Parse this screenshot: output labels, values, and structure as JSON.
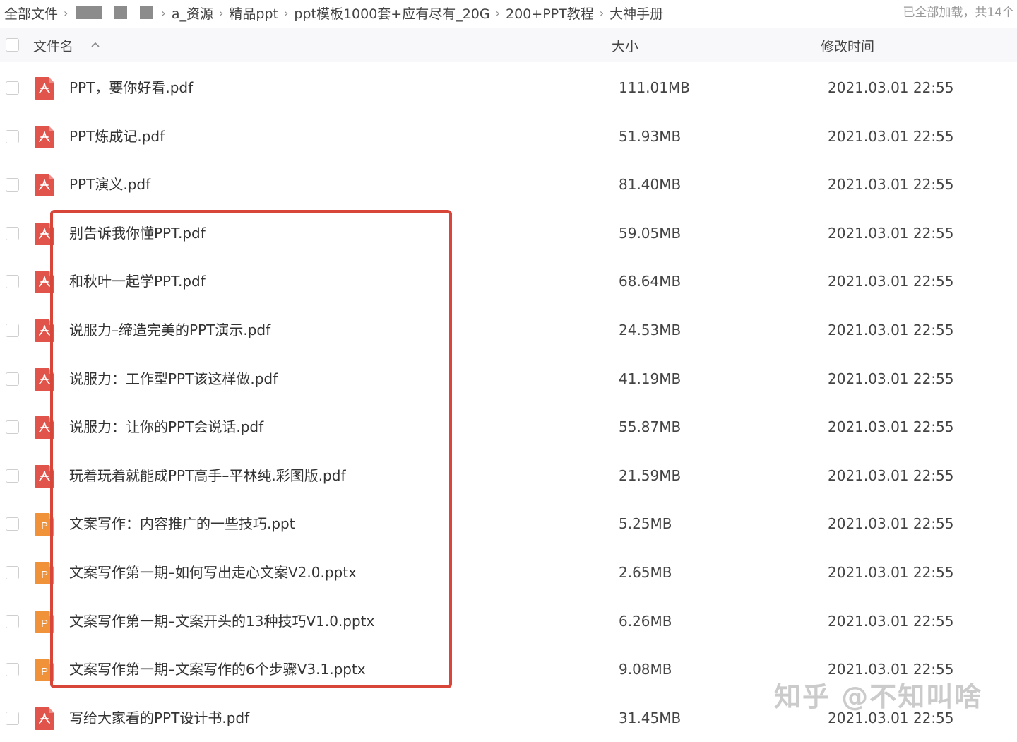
{
  "breadcrumb": [
    "全部文件",
    "a_资源",
    "精品ppt",
    "ppt模板1000套+应有尽有_20G",
    "200+PPT教程",
    "大神手册"
  ],
  "load_status": "已全部加载，共14个",
  "columns": {
    "name": "文件名",
    "size": "大小",
    "time": "修改时间"
  },
  "files": [
    {
      "name": "PPT，要你好看.pdf",
      "size": "111.01MB",
      "time": "2021.03.01 22:55",
      "type": "pdf"
    },
    {
      "name": "PPT炼成记.pdf",
      "size": "51.93MB",
      "time": "2021.03.01 22:55",
      "type": "pdf"
    },
    {
      "name": "PPT演义.pdf",
      "size": "81.40MB",
      "time": "2021.03.01 22:55",
      "type": "pdf"
    },
    {
      "name": "别告诉我你懂PPT.pdf",
      "size": "59.05MB",
      "time": "2021.03.01 22:55",
      "type": "pdf"
    },
    {
      "name": "和秋叶一起学PPT.pdf",
      "size": "68.64MB",
      "time": "2021.03.01 22:55",
      "type": "pdf"
    },
    {
      "name": "说服力–缔造完美的PPT演示.pdf",
      "size": "24.53MB",
      "time": "2021.03.01 22:55",
      "type": "pdf"
    },
    {
      "name": "说服力：工作型PPT该这样做.pdf",
      "size": "41.19MB",
      "time": "2021.03.01 22:55",
      "type": "pdf"
    },
    {
      "name": "说服力：让你的PPT会说话.pdf",
      "size": "55.87MB",
      "time": "2021.03.01 22:55",
      "type": "pdf"
    },
    {
      "name": "玩着玩着就能成PPT高手–平林纯.彩图版.pdf",
      "size": "21.59MB",
      "time": "2021.03.01 22:55",
      "type": "pdf"
    },
    {
      "name": "文案写作：内容推广的一些技巧.ppt",
      "size": "5.25MB",
      "time": "2021.03.01 22:55",
      "type": "ppt"
    },
    {
      "name": "文案写作第一期–如何写出走心文案V2.0.pptx",
      "size": "2.65MB",
      "time": "2021.03.01 22:55",
      "type": "ppt"
    },
    {
      "name": "文案写作第一期–文案开头的13种技巧V1.0.pptx",
      "size": "6.26MB",
      "time": "2021.03.01 22:55",
      "type": "ppt"
    },
    {
      "name": "文案写作第一期–文案写作的6个步骤V3.1.pptx",
      "size": "9.08MB",
      "time": "2021.03.01 22:55",
      "type": "ppt"
    },
    {
      "name": "写给大家看的PPT设计书.pdf",
      "size": "31.45MB",
      "time": "2021.03.01 22:55",
      "type": "pdf"
    }
  ],
  "ppt_icon_letter": "P",
  "watermark": "知乎 @不知叫啥",
  "colors": {
    "pdf_icon": "#e0544b",
    "ppt_icon": "#f0923a",
    "highlight_border": "#d8463a"
  }
}
